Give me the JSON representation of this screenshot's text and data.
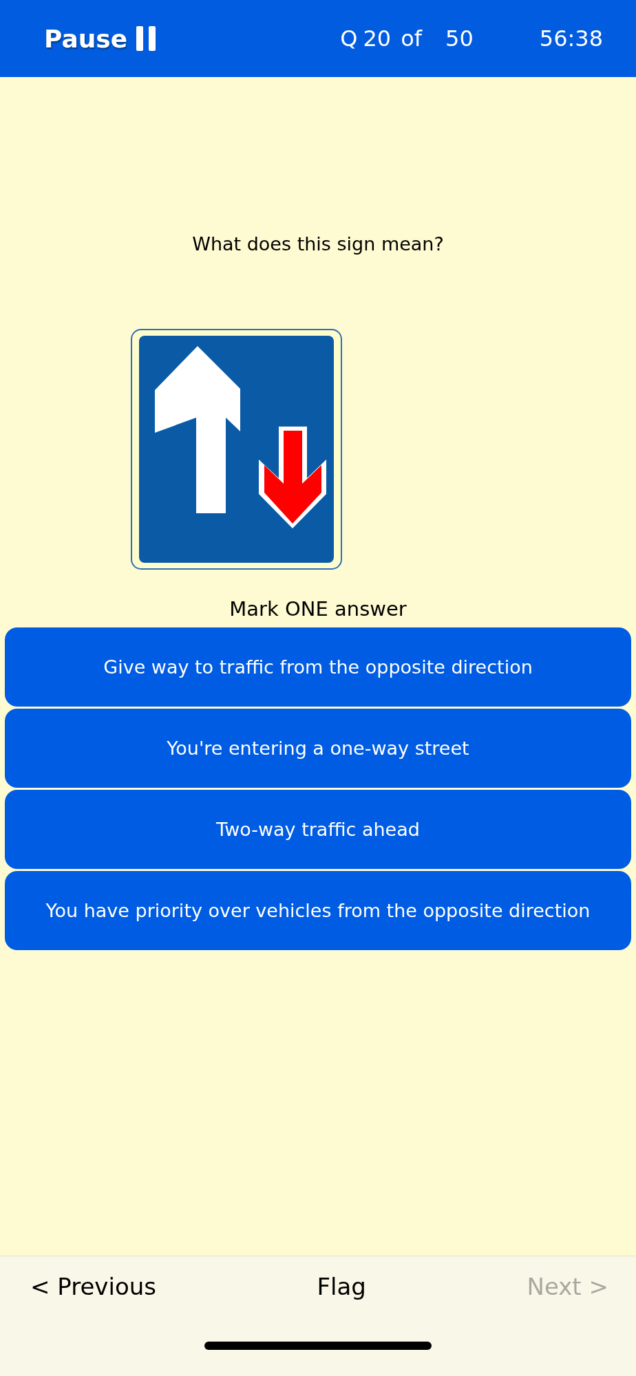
{
  "header": {
    "pause_label": "Pause",
    "question_prefix": "Q",
    "question_number": "20",
    "of_label": "of",
    "question_total": "50",
    "timer": "56:38"
  },
  "question": {
    "text": "What does this sign mean?",
    "picture": {
      "kind": "sign"
    },
    "instruction": "Mark ONE answer"
  },
  "answers": [
    {
      "text": "Give way to traffic from the opposite direction",
      "selected": false
    },
    {
      "text": "You're entering a one-way street",
      "selected": false
    },
    {
      "text": "Two-way traffic ahead",
      "selected": false
    },
    {
      "text": "You have priority over vehicles from the opposite direction",
      "selected": false
    }
  ],
  "footer": {
    "previous": {
      "label": "< Previous",
      "disabled": false
    },
    "flag": {
      "label": "Flag",
      "disabled": false
    },
    "next": {
      "label": "Next >",
      "disabled": true
    }
  }
}
